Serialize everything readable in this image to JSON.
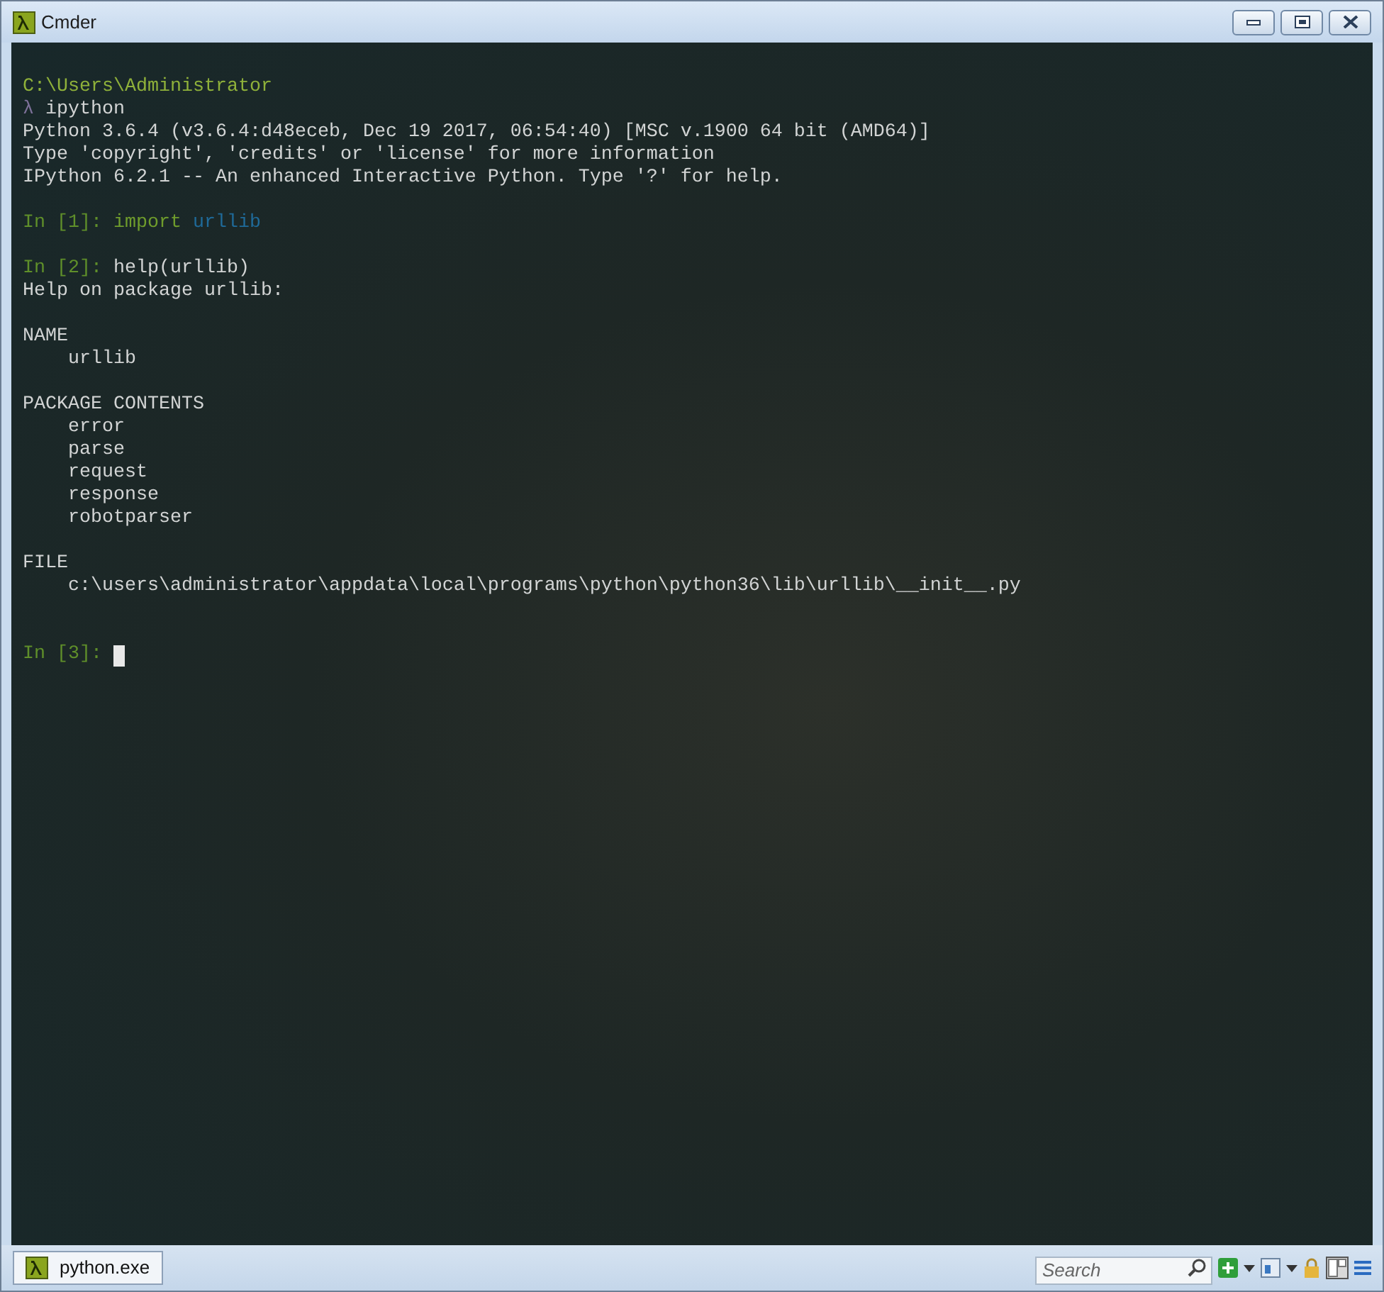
{
  "window": {
    "title": "Cmder"
  },
  "terminal": {
    "lines": [
      {
        "kind": "text",
        "segments": [
          {
            "kind": "path",
            "text": "C:\\Users\\Administrator"
          }
        ]
      },
      {
        "kind": "text",
        "segments": [
          {
            "kind": "lambda",
            "text": "λ"
          },
          {
            "kind": "plain",
            "text": " ipython"
          }
        ]
      },
      {
        "kind": "text",
        "segments": [
          {
            "kind": "plain",
            "text": "Python 3.6.4 (v3.6.4:d48eceb, Dec 19 2017, 06:54:40) [MSC v.1900 64 bit (AMD64)]"
          }
        ]
      },
      {
        "kind": "text",
        "segments": [
          {
            "kind": "plain",
            "text": "Type 'copyright', 'credits' or 'license' for more information"
          }
        ]
      },
      {
        "kind": "text",
        "segments": [
          {
            "kind": "plain",
            "text": "IPython 6.2.1 -- An enhanced Interactive Python. Type '?' for help."
          }
        ]
      },
      {
        "kind": "blank"
      },
      {
        "kind": "text",
        "segments": [
          {
            "kind": "prompt",
            "text": "In [1]: "
          },
          {
            "kind": "keyword",
            "text": "import "
          },
          {
            "kind": "module",
            "text": "urllib"
          }
        ]
      },
      {
        "kind": "blank"
      },
      {
        "kind": "text",
        "segments": [
          {
            "kind": "prompt",
            "text": "In [2]: "
          },
          {
            "kind": "plain",
            "text": "help(urllib)"
          }
        ]
      },
      {
        "kind": "text",
        "segments": [
          {
            "kind": "plain",
            "text": "Help on package urllib:"
          }
        ]
      },
      {
        "kind": "blank"
      },
      {
        "kind": "text",
        "segments": [
          {
            "kind": "plain",
            "text": "NAME"
          }
        ]
      },
      {
        "kind": "text",
        "segments": [
          {
            "kind": "plain",
            "text": "    urllib"
          }
        ]
      },
      {
        "kind": "blank"
      },
      {
        "kind": "text",
        "segments": [
          {
            "kind": "plain",
            "text": "PACKAGE CONTENTS"
          }
        ]
      },
      {
        "kind": "text",
        "segments": [
          {
            "kind": "plain",
            "text": "    error"
          }
        ]
      },
      {
        "kind": "text",
        "segments": [
          {
            "kind": "plain",
            "text": "    parse"
          }
        ]
      },
      {
        "kind": "text",
        "segments": [
          {
            "kind": "plain",
            "text": "    request"
          }
        ]
      },
      {
        "kind": "text",
        "segments": [
          {
            "kind": "plain",
            "text": "    response"
          }
        ]
      },
      {
        "kind": "text",
        "segments": [
          {
            "kind": "plain",
            "text": "    robotparser"
          }
        ]
      },
      {
        "kind": "blank"
      },
      {
        "kind": "text",
        "segments": [
          {
            "kind": "plain",
            "text": "FILE"
          }
        ]
      },
      {
        "kind": "text",
        "segments": [
          {
            "kind": "plain",
            "text": "    c:\\users\\administrator\\appdata\\local\\programs\\python\\python36\\lib\\urllib\\__init__.py"
          }
        ]
      },
      {
        "kind": "blank"
      },
      {
        "kind": "blank"
      },
      {
        "kind": "text",
        "cursor": true,
        "segments": [
          {
            "kind": "prompt",
            "text": "In [3]: "
          }
        ]
      }
    ]
  },
  "tabs": [
    {
      "label": "python.exe",
      "selected": true
    }
  ],
  "search": {
    "placeholder": "Search"
  }
}
